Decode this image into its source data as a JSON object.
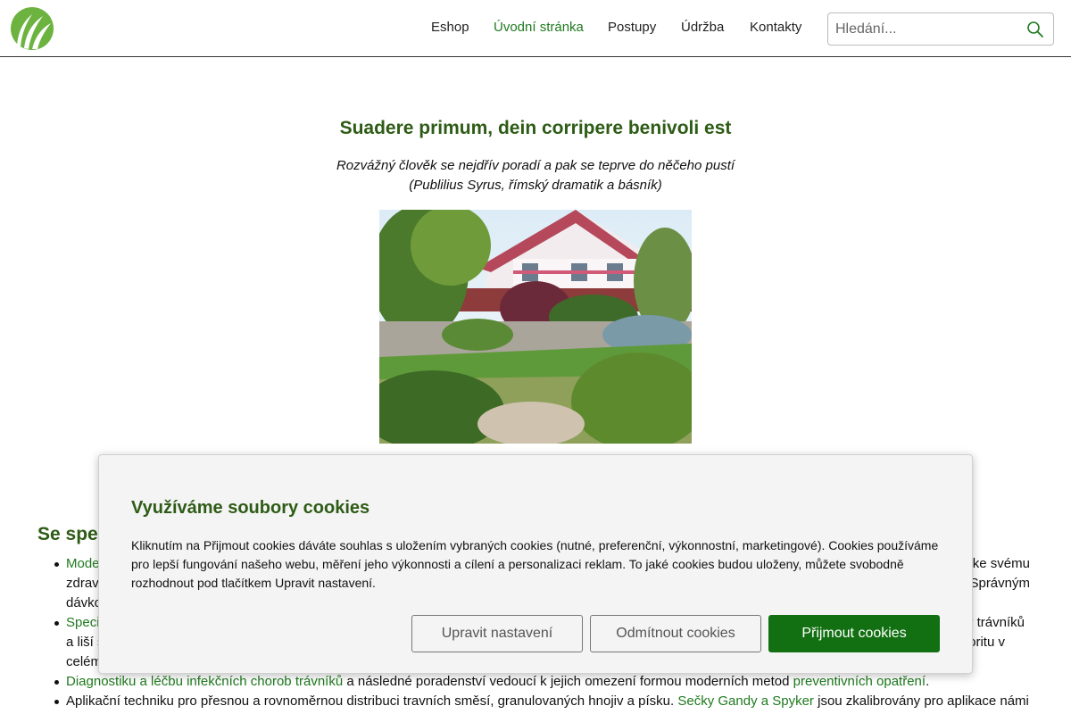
{
  "colors": {
    "brand_green": "#2e5c16",
    "link_green": "#1f7a1f",
    "accept_button": "#127012",
    "logo_green": "#6cb33f"
  },
  "header": {
    "logo_icon": "grass-leaves-logo-icon",
    "nav": [
      {
        "label": "Eshop",
        "active": false
      },
      {
        "label": "Úvodní stránka",
        "active": true
      },
      {
        "label": "Postupy",
        "active": false
      },
      {
        "label": "Údržba",
        "active": false
      },
      {
        "label": "Kontakty",
        "active": false
      }
    ],
    "search": {
      "placeholder": "Hledání...",
      "value": "",
      "icon": "search-icon"
    }
  },
  "main": {
    "title": "Suadere primum, dein corripere benivoli est",
    "quote_line1": "Rozvážný člověk se nejdřív poradí a pak se teprve do něčeho pustí",
    "quote_line2": "(Publilius Syrus, římský dramatik a básník)",
    "section_title": "Se spe",
    "list": [
      {
        "link1": "Mode",
        "text1": "",
        "right_fragment": "ke svému",
        "line2": "zdrav",
        "line2_right": "Správným",
        "line3": "dávko"
      },
      {
        "link1": "Speci",
        "right_fragment": "v trávníků",
        "line2": "a liší s",
        "line2_right": "oritu v",
        "line3": "celém"
      },
      {
        "link1": "Diagnostiku a léčbu infekčních chorob trávníků",
        "text1": " a následné poradenství vedoucí k jejich omezení formou moderních metod ",
        "link2": "preventivních opatření",
        "text2": "."
      },
      {
        "text0": "Aplikační techniku pro přesnou a rovnoměrnou distribuci travních směsí, granulovaných hnojiv a písku. ",
        "link1": "Sečky Gandy a Spyker",
        "text1": " jsou zkalibrovány pro aplikace námi"
      }
    ]
  },
  "cookie_banner": {
    "title": "Využíváme soubory cookies",
    "text": "Kliknutím na Přijmout cookies dáváte souhlas s uložením vybraných cookies (nutné, preferenční, výkonnostní, marketingové). Cookies používáme pro lepší fungování našeho webu, měření jeho výkonnosti a cílení a personalizaci reklam. To jaké cookies budou uloženy, můžete svobodně rozhodnout pod tlačítkem Upravit nastavení.",
    "buttons": {
      "settings": "Upravit nastavení",
      "reject": "Odmítnout cookies",
      "accept": "Přijmout cookies"
    }
  }
}
